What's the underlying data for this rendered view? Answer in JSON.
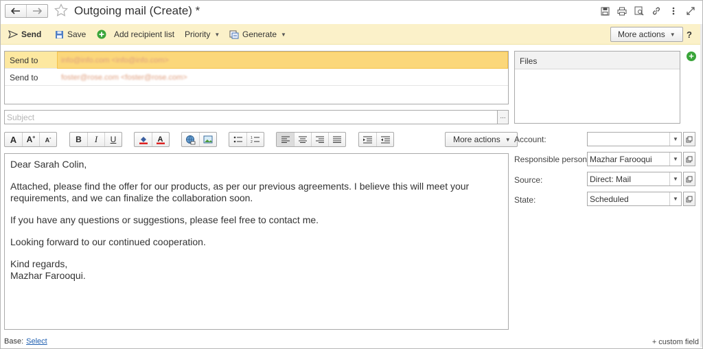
{
  "window": {
    "title": "Outgoing mail (Create) *"
  },
  "commandbar": {
    "send": "Send",
    "save": "Save",
    "add_recipient_list": "Add recipient list",
    "priority": "Priority",
    "generate": "Generate",
    "more_actions": "More actions",
    "help": "?"
  },
  "recipients": [
    {
      "label": "Send to",
      "value": "info@info.com <info@info.com>"
    },
    {
      "label": "Send to",
      "value": "foster@rose.com <foster@rose.com>"
    }
  ],
  "files": {
    "header": "Files"
  },
  "subject": {
    "placeholder": "Subject",
    "picker": "..."
  },
  "format_toolbar": {
    "more_actions": "More actions"
  },
  "body": {
    "paragraphs": [
      "Dear Sarah Colin,",
      "Attached, please find the offer for our products, as per our previous agreements. I believe this will meet your requirements, and we can finalize the collaboration soon.",
      "If you have any questions or suggestions, please feel free to contact me.",
      "Looking forward to our continued cooperation.",
      "Kind regards,",
      "Mazhar Farooqui."
    ]
  },
  "fields": {
    "account": {
      "label": "Account:",
      "value": ""
    },
    "responsible": {
      "label": "Responsible person:",
      "value": "Mazhar Farooqui"
    },
    "source": {
      "label": "Source:",
      "value": "Direct: Mail"
    },
    "state": {
      "label": "State:",
      "value": "Scheduled"
    }
  },
  "footer": {
    "base_label": "Base:",
    "select_link": "Select",
    "custom_field": "+ custom field"
  },
  "colors": {
    "command_bar_bg": "#fbf1c9",
    "selected_row": "#fbd77a",
    "link": "#1f5fb0",
    "add_green": "#3aa53a"
  },
  "icons": [
    "back-arrow-icon",
    "forward-arrow-icon",
    "star-icon",
    "save-disk-icon",
    "print-icon",
    "preview-icon",
    "link-icon",
    "kebab-menu-icon",
    "resize-icon",
    "send-icon",
    "add-icon"
  ]
}
